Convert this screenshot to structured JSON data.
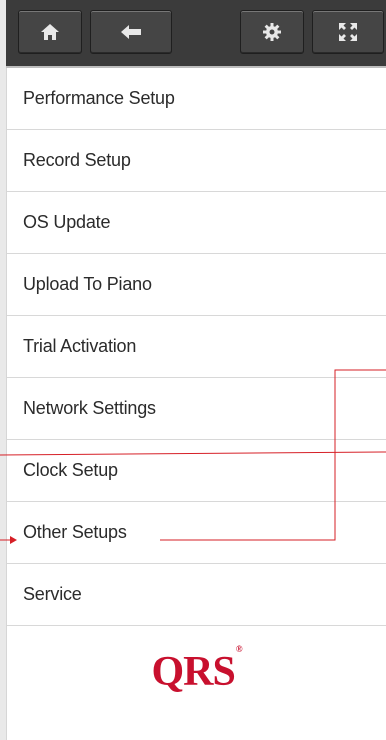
{
  "toolbar": {
    "buttons": [
      {
        "name": "home-button",
        "icon": "home-icon"
      },
      {
        "name": "back-button",
        "icon": "arrow-left-icon"
      },
      {
        "name": "settings-button",
        "icon": "gear-icon"
      },
      {
        "name": "fullscreen-button",
        "icon": "fullscreen-icon"
      }
    ]
  },
  "menu": {
    "items": [
      {
        "label": "Performance Setup"
      },
      {
        "label": "Record Setup"
      },
      {
        "label": "OS Update"
      },
      {
        "label": "Upload To Piano"
      },
      {
        "label": "Trial Activation"
      },
      {
        "label": "Network Settings"
      },
      {
        "label": "Clock Setup"
      },
      {
        "label": "Other Setups"
      },
      {
        "label": "Service"
      }
    ]
  },
  "footer": {
    "logo_text": "QRS",
    "logo_mark": "®"
  },
  "annotation": {
    "color": "#d61f26"
  }
}
